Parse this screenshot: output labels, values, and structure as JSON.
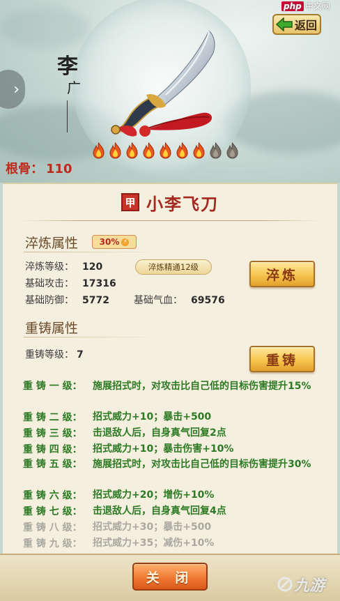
{
  "header": {
    "back_label": "返回",
    "watermark_text": "中文网",
    "watermark_brand": "php",
    "calligraphy_char1": "李",
    "calligraphy_char2": "广"
  },
  "root": {
    "label": "根骨：",
    "value": "110"
  },
  "flames": {
    "lit": 7,
    "total": 9
  },
  "weapon": {
    "grade_seal": "甲",
    "name": "小李飞刀"
  },
  "refine": {
    "title": "淬炼属性",
    "percent": "30%",
    "mastery": "淬炼精通12级",
    "button": "淬炼",
    "stats": [
      {
        "label": "淬炼等级：",
        "value": "120"
      },
      {
        "label": "基础攻击：",
        "value": "17316"
      },
      {
        "label": "基础防御：",
        "value": "5772"
      },
      {
        "label": "基础气血：",
        "value": "69576"
      }
    ]
  },
  "recast": {
    "title": "重铸属性",
    "level_label": "重铸等级：",
    "level_value": "7",
    "button": "重铸",
    "levels": [
      {
        "label": "重 铸 一 级：",
        "desc": "施展招式时，对攻击比自己低的目标伤害提升15%",
        "active": true
      },
      {
        "label": "重 铸 二 级：",
        "desc": "招式威力+10；暴击+500",
        "active": true
      },
      {
        "label": "重 铸 三 级：",
        "desc": "击退敌人后，自身真气回复2点",
        "active": true
      },
      {
        "label": "重 铸 四 级：",
        "desc": "招式威力+10；暴击伤害+10%",
        "active": true
      },
      {
        "label": "重 铸 五 级：",
        "desc": "施展招式时，对攻击比自己低的目标伤害提升30%",
        "active": true
      },
      {
        "label": "重 铸 六 级：",
        "desc": "招式威力+20；增伤+10%",
        "active": true
      },
      {
        "label": "重 铸 七 级：",
        "desc": "击退敌人后，自身真气回复4点",
        "active": true
      },
      {
        "label": "重 铸 八 级：",
        "desc": "招式威力+30；暴击+500",
        "active": false
      },
      {
        "label": "重 铸 九 级：",
        "desc": "招式威力+35；减伤+10%",
        "active": false
      }
    ]
  },
  "footer": {
    "close_label": "关 闭",
    "logo_text": "九游"
  },
  "colors": {
    "active_green": "#2c7a23",
    "inactive_gray": "#a9a9a0",
    "accent_red": "#c0281c"
  }
}
